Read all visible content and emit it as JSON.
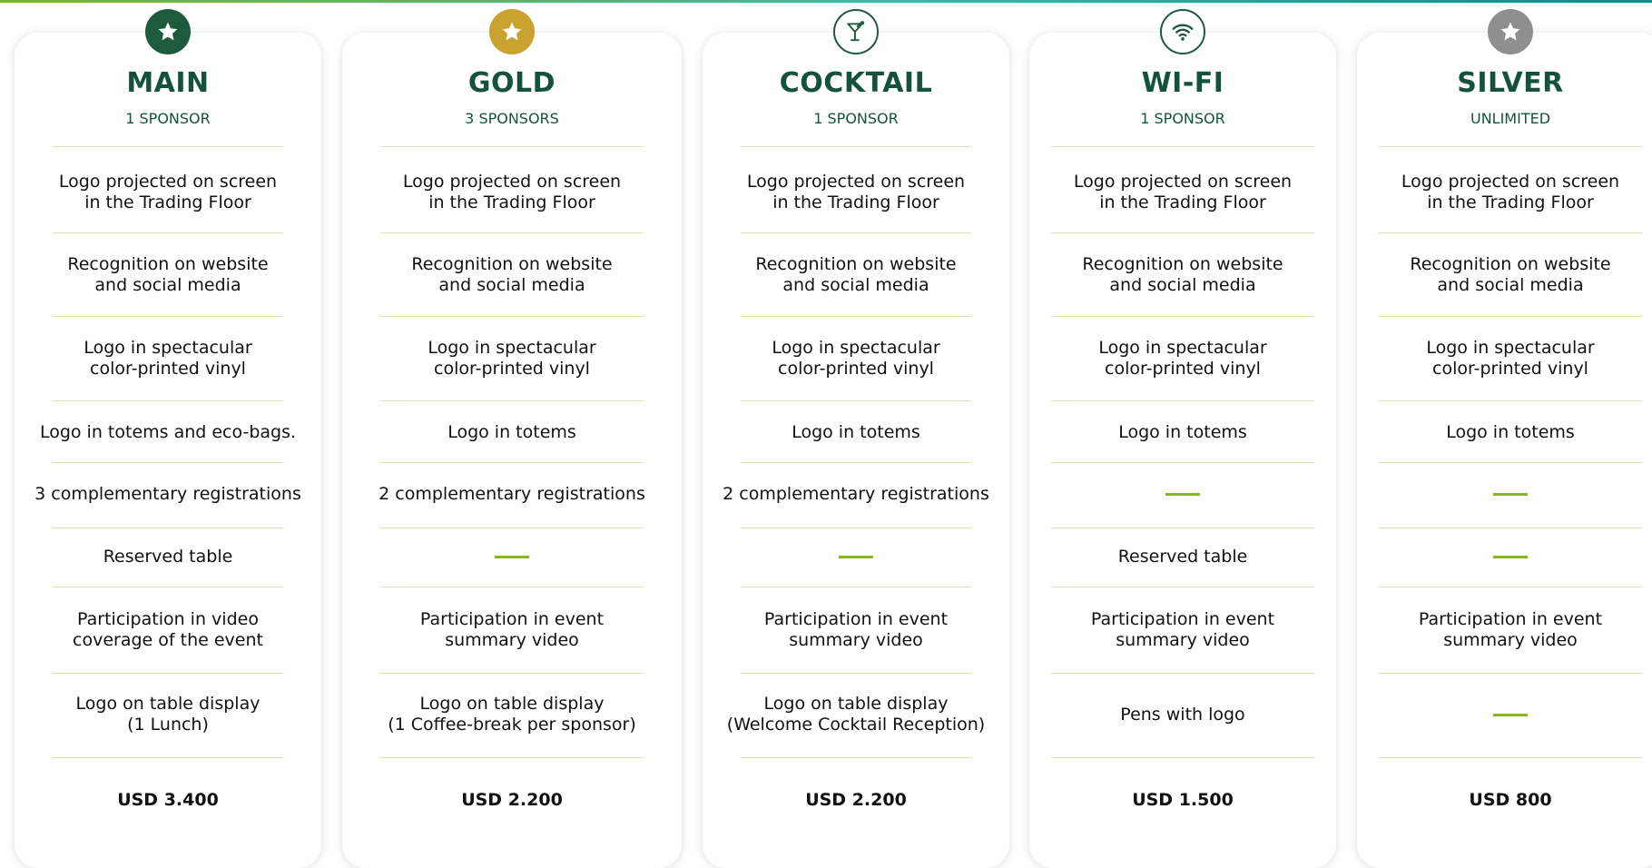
{
  "colors": {
    "title": "#14533a",
    "accent_line": "#8ab61e",
    "divider": "#d7e6ad",
    "badge_main": "#1e5a3c",
    "badge_gold": "#c9a230",
    "badge_silver": "#8f8f8f"
  },
  "tiers": [
    {
      "key": "main",
      "title": "MAIN",
      "subtitle": "1 SPONSOR",
      "icon": "star-icon",
      "features": [
        "Logo projected on screen\nin the Trading Floor",
        "Recognition on website\nand social media",
        "Logo in spectacular\ncolor-printed vinyl",
        "Logo in totems and eco-bags.",
        "3 complementary registrations",
        "Reserved table",
        "Participation in video\ncoverage of the event",
        "Logo on table display\n(1 Lunch)"
      ],
      "price": "USD 3.400"
    },
    {
      "key": "gold",
      "title": "GOLD",
      "subtitle": "3 SPONSORS",
      "icon": "star-icon",
      "features": [
        "Logo projected on screen\nin the Trading Floor",
        "Recognition on website\nand social media",
        "Logo in spectacular\ncolor-printed vinyl",
        "Logo in totems",
        "2 complementary registrations",
        "",
        "Participation in event\nsummary video",
        "Logo on table display\n(1 Coffee-break per sponsor)"
      ],
      "price": "USD 2.200"
    },
    {
      "key": "cocktail",
      "title": "COCKTAIL",
      "subtitle": "1 SPONSOR",
      "icon": "cocktail-glass-icon",
      "features": [
        "Logo projected on screen\nin the Trading Floor",
        "Recognition on website\nand social media",
        "Logo in spectacular\ncolor-printed vinyl",
        "Logo in totems",
        "2 complementary registrations",
        "",
        "Participation in event\nsummary video",
        "Logo on table display\n(Welcome Cocktail Reception)"
      ],
      "price": "USD 2.200"
    },
    {
      "key": "wifi",
      "title": "WI-FI",
      "subtitle": "1 SPONSOR",
      "icon": "wifi-icon",
      "features": [
        "Logo projected on screen\nin the Trading Floor",
        "Recognition on website\nand social media",
        "Logo in spectacular\ncolor-printed vinyl",
        "Logo in totems",
        "",
        "Reserved table",
        "Participation in event\nsummary video",
        "Pens with logo"
      ],
      "price": "USD 1.500"
    },
    {
      "key": "silver",
      "title": "SILVER",
      "subtitle": "UNLIMITED",
      "icon": "star-icon",
      "features": [
        "Logo projected on screen\nin the Trading Floor",
        "Recognition on website\nand social media",
        "Logo in spectacular\ncolor-printed vinyl",
        "Logo in totems",
        "",
        "",
        "Participation in event\nsummary video",
        ""
      ],
      "price": "USD 800"
    }
  ]
}
